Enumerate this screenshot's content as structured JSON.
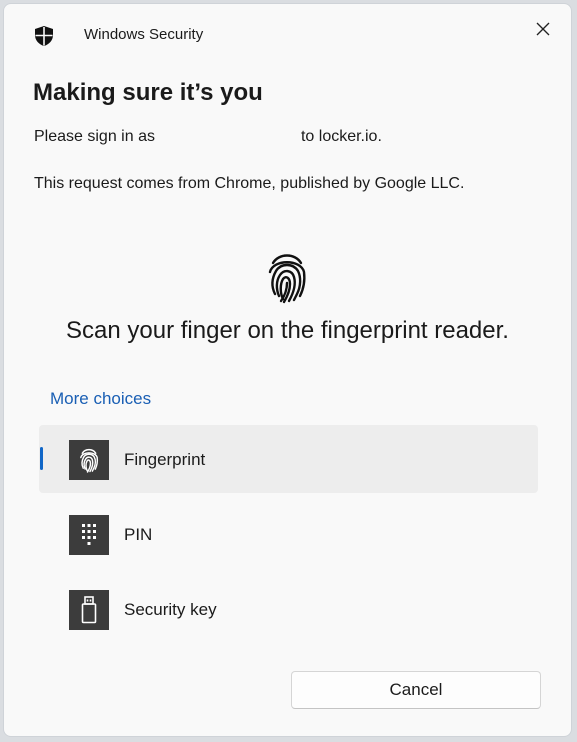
{
  "titlebar": {
    "app_title": "Windows Security",
    "app_icon": "shield-icon",
    "close_icon": "close-icon"
  },
  "main": {
    "heading": "Making sure it’s you",
    "signin_prefix": "Please sign in as",
    "signin_suffix": "to locker.io.",
    "request_text": "This request comes from Chrome, published by Google LLC.",
    "prompt_icon": "fingerprint-icon",
    "scan_instruction": "Scan your finger on the fingerprint reader.",
    "more_choices_label": "More choices"
  },
  "options": [
    {
      "label": "Fingerprint",
      "icon": "fingerprint-icon",
      "selected": true
    },
    {
      "label": "PIN",
      "icon": "keypad-icon",
      "selected": false
    },
    {
      "label": "Security key",
      "icon": "usb-key-icon",
      "selected": false
    }
  ],
  "footer": {
    "cancel_label": "Cancel"
  },
  "colors": {
    "accent": "#1066c7",
    "link": "#1a5fb4",
    "tile": "#3c3c3c",
    "selected_bg": "#ededed"
  }
}
